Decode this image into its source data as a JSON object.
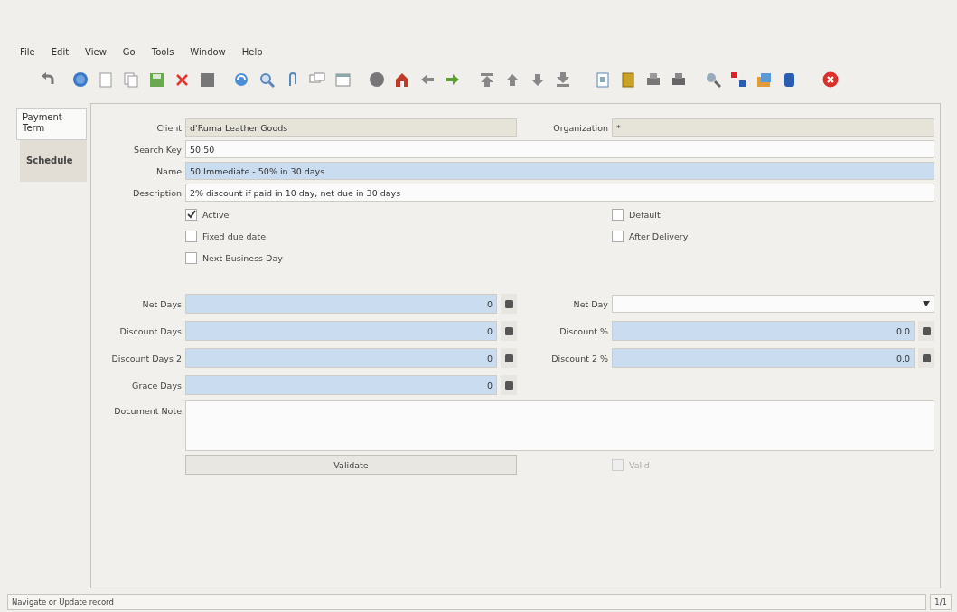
{
  "menu": [
    "File",
    "Edit",
    "View",
    "Go",
    "Tools",
    "Window",
    "Help"
  ],
  "tabs": [
    {
      "label": "Payment Term",
      "selected": true
    },
    {
      "label": "Schedule",
      "selected": false
    }
  ],
  "rows": [
    {
      "kind": "pair",
      "left": {
        "label": "Client",
        "value": "d'Ruma Leather Goods",
        "kind": "text",
        "readonly": true,
        "mandatory": false
      },
      "right": {
        "label": "Organization",
        "value": "*",
        "kind": "text",
        "readonly": true,
        "mandatory": false
      }
    },
    {
      "kind": "wide",
      "left": {
        "label": "Search Key",
        "value": "50:50",
        "kind": "text",
        "readonly": false,
        "mandatory": false
      }
    },
    {
      "kind": "wide",
      "left": {
        "label": "Name",
        "value": "50 Immediate - 50% in 30 days",
        "kind": "text",
        "readonly": false,
        "mandatory": true
      }
    },
    {
      "kind": "wide",
      "left": {
        "label": "Description",
        "value": "2% discount if paid in 10 day, net due in 30 days",
        "kind": "text",
        "readonly": false,
        "mandatory": false
      }
    },
    {
      "kind": "checks",
      "left": {
        "label": "Active",
        "checked": true
      },
      "right": {
        "label": "Default",
        "checked": false
      }
    },
    {
      "kind": "checks",
      "left": {
        "label": "Fixed due date",
        "checked": false
      },
      "right": {
        "label": "After Delivery",
        "checked": false
      }
    },
    {
      "kind": "checks",
      "left": {
        "label": "Next Business Day",
        "checked": false
      }
    },
    {
      "kind": "pair",
      "left": {
        "label": "Net Days",
        "value": "0",
        "kind": "number",
        "readonly": false,
        "mandatory": true
      },
      "right": {
        "label": "Net Day",
        "kind": "combo",
        "readonly": false,
        "mandatory": false
      }
    },
    {
      "kind": "pair",
      "left": {
        "label": "Discount Days",
        "value": "0",
        "kind": "number",
        "readonly": false,
        "mandatory": true
      },
      "right": {
        "label": "Discount %",
        "value": "0.0",
        "kind": "number",
        "readonly": false,
        "mandatory": true
      }
    },
    {
      "kind": "pair",
      "left": {
        "label": "Discount Days 2",
        "value": "0",
        "kind": "number",
        "readonly": false,
        "mandatory": true
      },
      "right": {
        "label": "Discount 2 %",
        "value": "0.0",
        "kind": "number",
        "readonly": false,
        "mandatory": true
      }
    },
    {
      "kind": "pair",
      "left": {
        "label": "Grace Days",
        "value": "0",
        "kind": "number",
        "readonly": false,
        "mandatory": true
      }
    },
    {
      "kind": "note",
      "left": {
        "label": "Document Note",
        "kind": "textarea",
        "readonly": false,
        "mandatory": false
      }
    },
    {
      "kind": "actions",
      "left": {
        "label": "Validate",
        "kind": "button"
      },
      "right": {
        "label": "Valid",
        "kind": "check",
        "checked": false,
        "disabled": true
      }
    }
  ],
  "status_bar": {
    "message": "Navigate or Update record",
    "record": "1/1"
  }
}
